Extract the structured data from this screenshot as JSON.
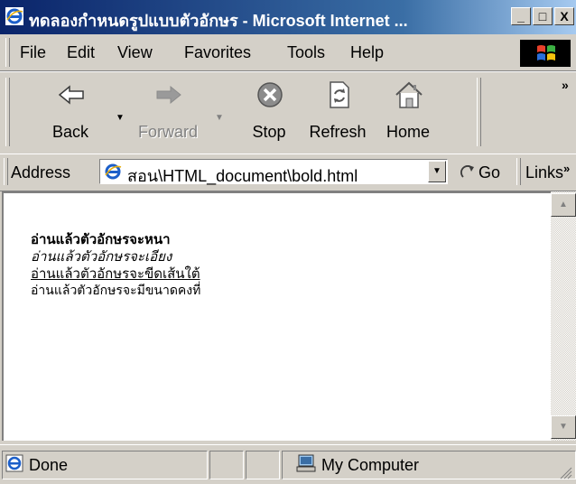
{
  "window": {
    "title": "ทดลองกำหนดรูปแบบตัวอักษร - Microsoft Internet ...",
    "minimize_glyph": "_",
    "maximize_glyph": "□",
    "close_glyph": "X"
  },
  "menu": {
    "items": [
      "File",
      "Edit",
      "View",
      "Favorites",
      "Tools",
      "Help"
    ]
  },
  "toolbar": {
    "buttons": [
      {
        "label": "Back",
        "icon": "back-arrow-icon",
        "enabled": true
      },
      {
        "label": "Forward",
        "icon": "forward-arrow-icon",
        "enabled": false
      },
      {
        "label": "Stop",
        "icon": "stop-icon",
        "enabled": true
      },
      {
        "label": "Refresh",
        "icon": "refresh-icon",
        "enabled": true
      },
      {
        "label": "Home",
        "icon": "home-icon",
        "enabled": true
      }
    ],
    "more_glyph": "»"
  },
  "address": {
    "label": "Address",
    "value": "สอน\\HTML_document\\bold.html",
    "go_label": "Go",
    "links_label": "Links",
    "links_more": "»"
  },
  "content": {
    "lines": [
      {
        "text": "อ่านแล้วตัวอักษรจะหนา",
        "style": "bold"
      },
      {
        "text": "อ่านแล้วตัวอักษรจะเอียง",
        "style": "italic"
      },
      {
        "text": "อ่านแล้วตัวอักษรจะขีดเส้นใต้",
        "style": "underline"
      },
      {
        "text": "อ่านแล้วตัวอักษรจะมีขนาดคงที่",
        "style": "monospace"
      }
    ]
  },
  "status": {
    "text": "Done",
    "zone": "My Computer"
  },
  "colors": {
    "titlebar_start": "#0a246a",
    "titlebar_end": "#a6caf0",
    "chrome": "#d4d0c8"
  }
}
